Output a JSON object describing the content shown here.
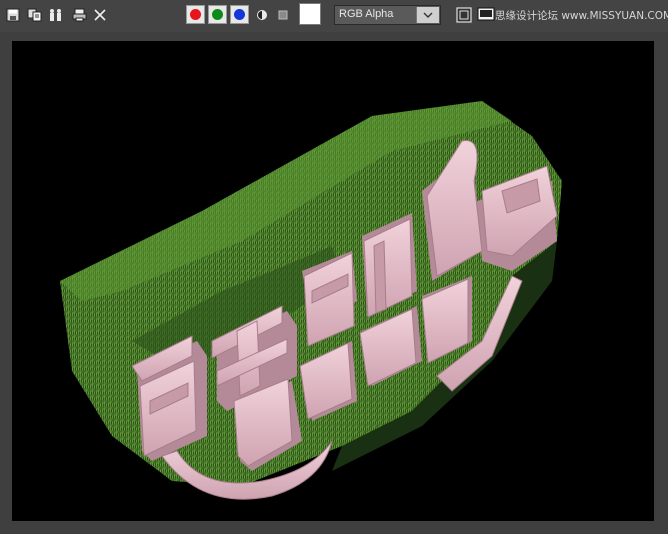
{
  "toolbar": {
    "icons": [
      "save-image-icon",
      "copy-image-icon",
      "clone-window-icon",
      "print-image-icon",
      "clear-icon"
    ],
    "channels": [
      {
        "name": "red-channel",
        "color": "#e8141b"
      },
      {
        "name": "green-channel",
        "color": "#0e8a1b"
      },
      {
        "name": "blue-channel",
        "color": "#1438d8"
      }
    ],
    "display_mode_label": "RGB Alpha",
    "watermark": "思缘设计论坛 www.MISSYUAN.COM"
  },
  "render": {
    "text_color": "#e6c1cc",
    "grass_color": "#3a6b22",
    "background": "#000000"
  }
}
